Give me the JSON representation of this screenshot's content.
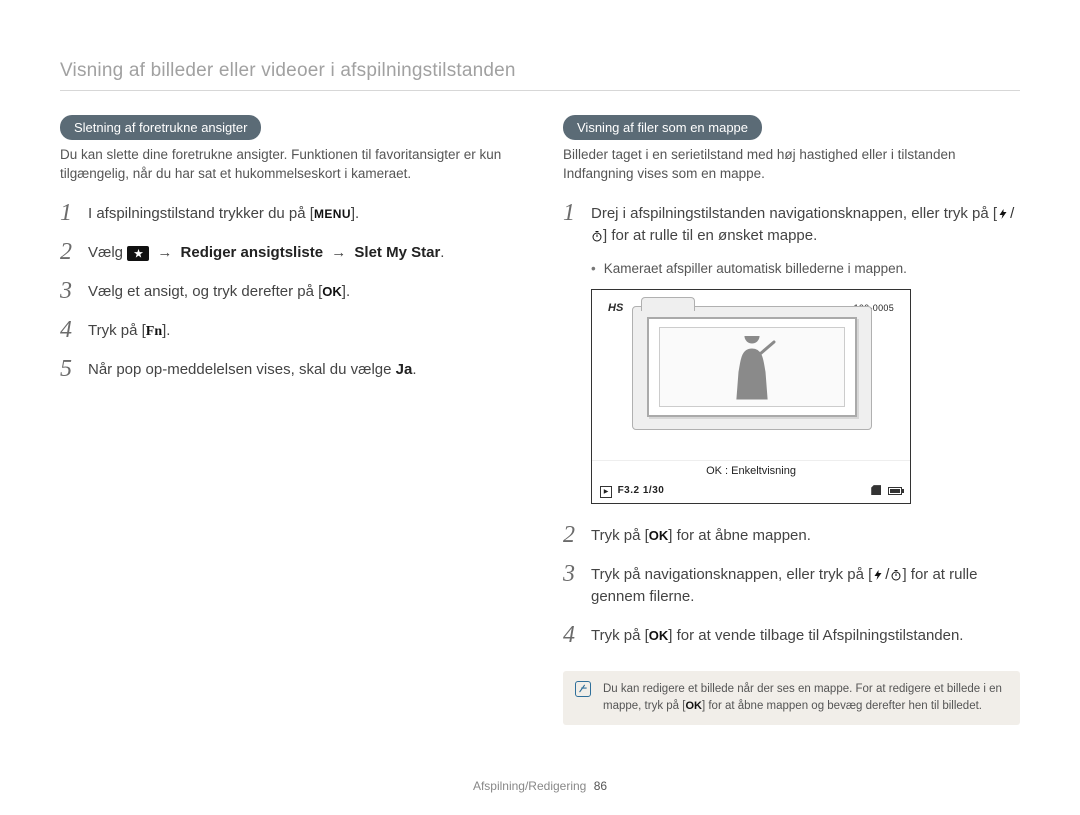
{
  "page_title": "Visning af billeder eller videoer i afspilningstilstanden",
  "left": {
    "heading": "Sletning af foretrukne ansigter",
    "intro": "Du kan slette dine foretrukne ansigter. Funktionen til favoritansigter er kun tilgængelig, når du har sat et hukommelseskort i kameraet.",
    "steps": {
      "s1_a": "I afspilningstilstand trykker du på [",
      "s1_menu": "MENU",
      "s1_b": "].",
      "s2_a": "Vælg ",
      "s2_arrow": "→",
      "s2_b1": "Rediger ansigtsliste",
      "s2_b2": "Slet My Star",
      "s2_c": ".",
      "s3_a": "Vælg et ansigt, og tryk derefter på [",
      "s3_ok": "OK",
      "s3_b": "].",
      "s4_a": "Tryk på [",
      "s4_fn": "Fn",
      "s4_b": "].",
      "s5_a": "Når pop op-meddelelsen vises, skal du vælge ",
      "s5_ja": "Ja",
      "s5_b": "."
    }
  },
  "right": {
    "heading": "Visning af filer som en mappe",
    "intro": "Billeder taget i en serietilstand med høj hastighed eller i tilstanden Indfangning vises som en mappe.",
    "steps": {
      "s1_a": "Drej i afspilningstilstanden navigationsknappen, eller tryk på [",
      "s1_b": "] for at rulle til en ønsket mappe.",
      "s1_bullet": "Kameraet afspiller automatisk billederne i mappen.",
      "s2_a": "Tryk på [",
      "s2_ok": "OK",
      "s2_b": "] for at åbne mappen.",
      "s3_a": "Tryk på navigationsknappen, eller tryk på [",
      "s3_b": "] for at rulle gennem filerne.",
      "s4_a": "Tryk på [",
      "s4_ok": "OK",
      "s4_b": "] for at vende tilbage til Afspilningstilstanden."
    },
    "figure": {
      "hs": "HS",
      "file_index": "100-0005",
      "ok_caption": "OK : Enkeltvisning",
      "f_label": "F3.2  1/30"
    },
    "note_a": "Du kan redigere et billede når der ses en mappe. For at redigere et billede i en mappe, tryk på [",
    "note_ok": "OK",
    "note_b": "] for at åbne mappen og bevæg derefter hen til billedet."
  },
  "footer": {
    "section": "Afspilning/Redigering",
    "page": "86"
  },
  "icons": {
    "slash": "/"
  }
}
